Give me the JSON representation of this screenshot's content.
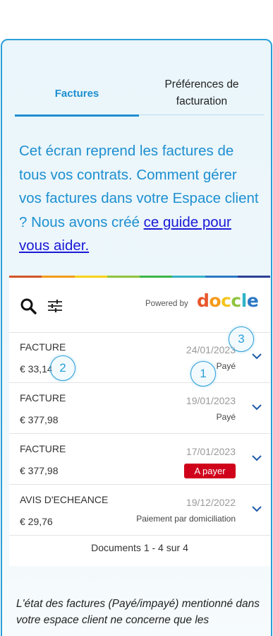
{
  "tabs": [
    {
      "label": "Factures"
    },
    {
      "label": "Préférences de facturation"
    }
  ],
  "intro": {
    "text": "Cet écran reprend les factures de tous vos contrats. Comment gérer vos factures dans votre Espace client ? Nous avons créé ",
    "link": "ce guide pour vous aider."
  },
  "toolbar": {
    "search_icon": "search-icon",
    "filter_icon": "sliders-icon",
    "powered_by": "Powered by",
    "logo_text": "doccle"
  },
  "rows": [
    {
      "type": "FACTURE",
      "amount": "€ 33,14",
      "date": "24/01/2023",
      "status": "Payé"
    },
    {
      "type": "FACTURE",
      "amount": "€ 377,98",
      "date": "19/01/2023",
      "status": "Payé"
    },
    {
      "type": "FACTURE",
      "amount": "€ 377,98",
      "date": "17/01/2023",
      "status": "A payer"
    },
    {
      "type": "AVIS D'ECHEANCE",
      "amount": "€ 29,76",
      "date": "19/12/2022",
      "status": "Paiement par domiciliation"
    }
  ],
  "documents_count": "Documents 1 - 4 sur 4",
  "note": "L'état des factures (Payé/impayé) mentionné dans votre espace client ne concerne que les",
  "markers": [
    "1",
    "2",
    "3"
  ],
  "colors": {
    "accent": "#1e8fd0",
    "pay_button": "#d0021b",
    "rainbow": [
      "#d2552b",
      "#f29a1b",
      "#f6d21b",
      "#8fc43f",
      "#3bb54a",
      "#36b1c7",
      "#2b78c4",
      "#2a3f97"
    ],
    "logo": [
      "#e8562a",
      "#f49b1c",
      "#f3c51c",
      "#8fc43f",
      "#2fb4c8",
      "#2b78c4"
    ]
  }
}
